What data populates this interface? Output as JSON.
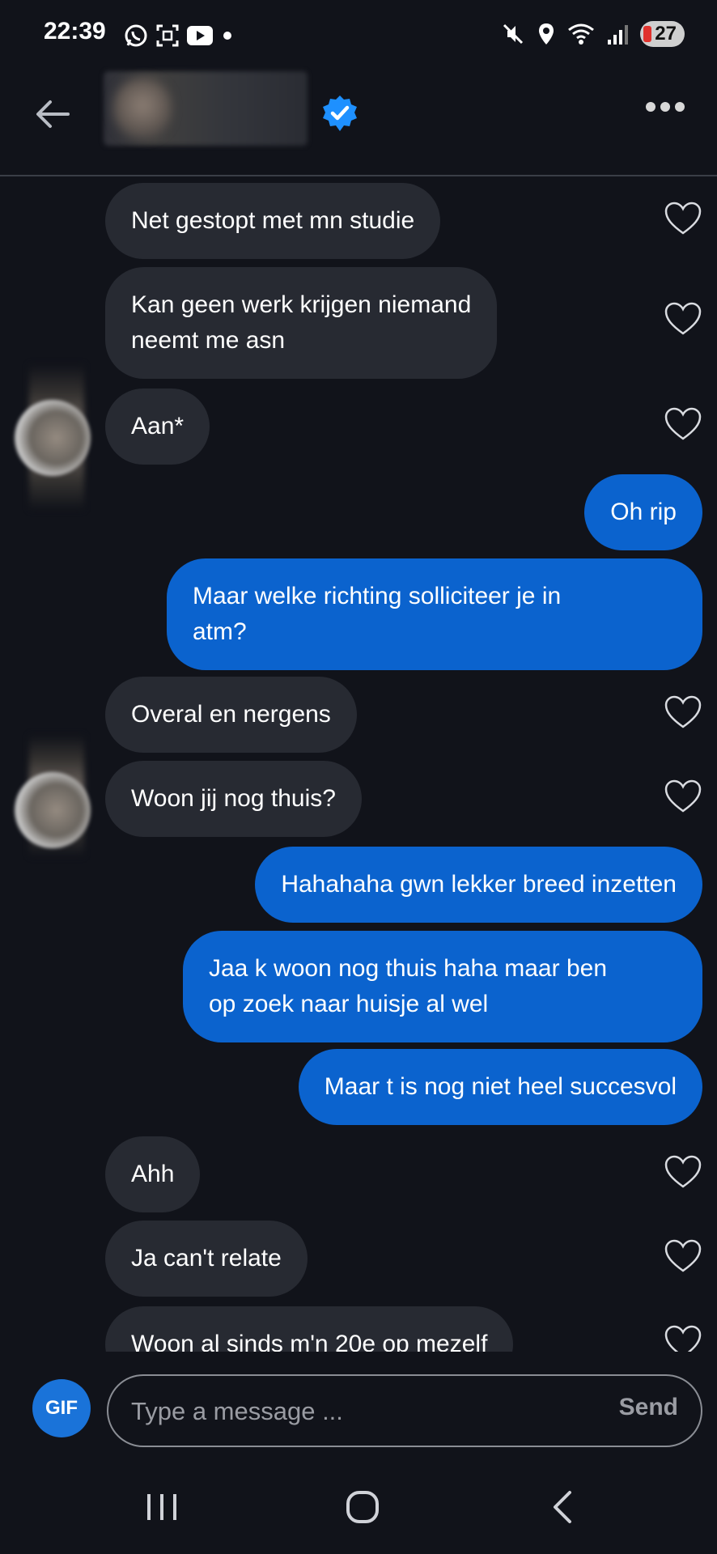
{
  "status_bar": {
    "time": "22:39",
    "battery": "27",
    "icons_left": [
      "whatsapp-icon",
      "screenshot-icon",
      "youtube-icon",
      "notification-dot"
    ],
    "icons_right": [
      "mute-icon",
      "location-icon",
      "wifi-icon",
      "signal-icon",
      "battery-icon"
    ]
  },
  "header": {
    "back_icon": "arrow-left-icon",
    "verified_icon": "verified-badge-icon",
    "more_icon": "more-dots-icon"
  },
  "messages": [
    {
      "side": "in",
      "text_lines": [
        "Net gestopt met mn studie"
      ]
    },
    {
      "side": "in",
      "text_lines": [
        "Kan geen werk krijgen niemand",
        "neemt me asn"
      ]
    },
    {
      "side": "in",
      "text_lines": [
        "Aan*"
      ]
    },
    {
      "side": "out",
      "text_lines": [
        "Oh rip"
      ]
    },
    {
      "side": "out",
      "text_lines": [
        "Maar welke richting solliciteer je in",
        "atm?"
      ]
    },
    {
      "side": "in",
      "text_lines": [
        "Overal en nergens"
      ]
    },
    {
      "side": "in",
      "text_lines": [
        "Woon jij nog thuis?"
      ]
    },
    {
      "side": "out",
      "text_lines": [
        "Hahahaha gwn lekker breed inzetten"
      ]
    },
    {
      "side": "out",
      "text_lines": [
        "Jaa k woon nog thuis haha maar ben",
        "op zoek naar huisje al wel"
      ]
    },
    {
      "side": "out",
      "text_lines": [
        "Maar t is nog niet heel succesvol"
      ]
    },
    {
      "side": "in",
      "text_lines": [
        "Ahh"
      ]
    },
    {
      "side": "in",
      "text_lines": [
        "Ja can't relate"
      ]
    },
    {
      "side": "in",
      "text_lines": [
        "Woon al sinds m'n 20e op mezelf"
      ]
    }
  ],
  "composer": {
    "gif_label": "GIF",
    "placeholder": "Type a message ...",
    "send_label": "Send"
  },
  "nav": [
    "recent-apps-icon",
    "home-icon",
    "back-icon"
  ],
  "colors": {
    "background": "#11131a",
    "incoming_bubble": "#272a32",
    "outgoing_bubble": "#0b63ce",
    "accent": "#1a73d9"
  }
}
